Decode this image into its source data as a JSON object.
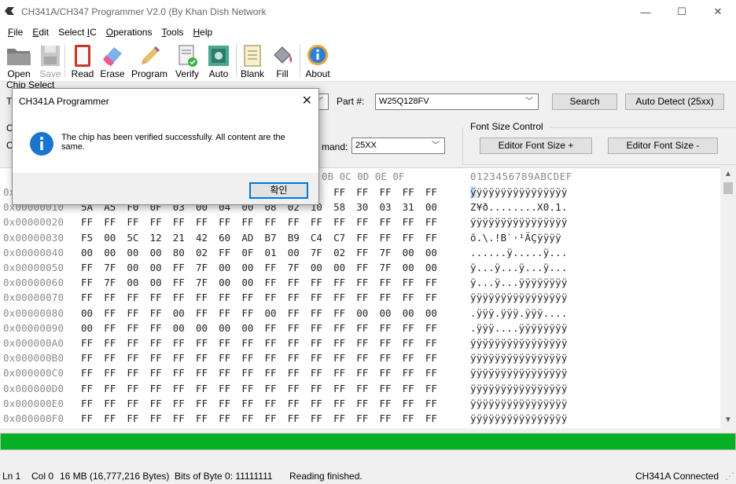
{
  "window": {
    "title": "CH341A/CH347 Programmer V2.0 (By Khan Dish Network",
    "minimize": "—",
    "maximize": "☐",
    "close": "✕"
  },
  "menu": [
    {
      "label": "File"
    },
    {
      "label": "Edit"
    },
    {
      "label": "Select IC"
    },
    {
      "label": "Operations"
    },
    {
      "label": "Tools"
    },
    {
      "label": "Help"
    }
  ],
  "toolbar": {
    "open": "Open",
    "save": "Save",
    "read": "Read",
    "erase": "Erase",
    "program": "Program",
    "verify": "Verify",
    "auto": "Auto",
    "blank": "Blank",
    "fill": "Fill",
    "about": "About"
  },
  "chip_select": {
    "group_label": "Chip Select",
    "part_label": "Part #:",
    "part_value": "W25Q128FV",
    "search": "Search",
    "auto_detect": "Auto Detect (25xx)",
    "command_label": "mand:",
    "command_value": "25XX",
    "partial_type_label": "T",
    "partial_c1": "C",
    "partial_c2": "C"
  },
  "font_size": {
    "group_label": "Font Size Control",
    "increase": "Editor Font Size +",
    "decrease": "Editor Font Size -"
  },
  "hex": {
    "header_cols": "A 0B 0C 0D 0E 0F",
    "ascii_header": "0123456789ABCDEF",
    "rows": [
      {
        "addr": "0x",
        "bytes": [
          "",
          "",
          "",
          "",
          "",
          "",
          "",
          "",
          "",
          "",
          "F",
          "FF",
          "FF",
          "FF",
          "FF",
          "FF"
        ],
        "ascii": "ÿÿÿÿÿÿÿÿÿÿÿÿÿÿÿÿ"
      },
      {
        "addr": "0x00000010",
        "bytes": [
          "5A",
          "A5",
          "F0",
          "0F",
          "03",
          "00",
          "04",
          "00",
          "08",
          "02",
          "10",
          "58",
          "30",
          "03",
          "31",
          "00"
        ],
        "ascii": "Z¥ð........X0.1."
      },
      {
        "addr": "0x00000020",
        "bytes": [
          "FF",
          "FF",
          "FF",
          "FF",
          "FF",
          "FF",
          "FF",
          "FF",
          "FF",
          "FF",
          "FF",
          "FF",
          "FF",
          "FF",
          "FF",
          "FF"
        ],
        "ascii": "ÿÿÿÿÿÿÿÿÿÿÿÿÿÿÿÿ"
      },
      {
        "addr": "0x00000030",
        "bytes": [
          "F5",
          "00",
          "5C",
          "12",
          "21",
          "42",
          "60",
          "AD",
          "B7",
          "B9",
          "C4",
          "C7",
          "FF",
          "FF",
          "FF",
          "FF"
        ],
        "ascii": "õ.\\.!B`­·¹ÄÇÿÿÿÿ"
      },
      {
        "addr": "0x00000040",
        "bytes": [
          "00",
          "00",
          "00",
          "00",
          "80",
          "02",
          "FF",
          "0F",
          "01",
          "00",
          "7F",
          "02",
          "FF",
          "7F",
          "00",
          "00"
        ],
        "ascii": "......ÿ.....ÿ..."
      },
      {
        "addr": "0x00000050",
        "bytes": [
          "FF",
          "7F",
          "00",
          "00",
          "FF",
          "7F",
          "00",
          "00",
          "FF",
          "7F",
          "00",
          "00",
          "FF",
          "7F",
          "00",
          "00"
        ],
        "ascii": "ÿ...ÿ...ÿ...ÿ..."
      },
      {
        "addr": "0x00000060",
        "bytes": [
          "FF",
          "7F",
          "00",
          "00",
          "FF",
          "7F",
          "00",
          "00",
          "FF",
          "FF",
          "FF",
          "FF",
          "FF",
          "FF",
          "FF",
          "FF"
        ],
        "ascii": "ÿ...ÿ...ÿÿÿÿÿÿÿÿ"
      },
      {
        "addr": "0x00000070",
        "bytes": [
          "FF",
          "FF",
          "FF",
          "FF",
          "FF",
          "FF",
          "FF",
          "FF",
          "FF",
          "FF",
          "FF",
          "FF",
          "FF",
          "FF",
          "FF",
          "FF"
        ],
        "ascii": "ÿÿÿÿÿÿÿÿÿÿÿÿÿÿÿÿ"
      },
      {
        "addr": "0x00000080",
        "bytes": [
          "00",
          "FF",
          "FF",
          "FF",
          "00",
          "FF",
          "FF",
          "FF",
          "00",
          "FF",
          "FF",
          "FF",
          "00",
          "00",
          "00",
          "00"
        ],
        "ascii": ".ÿÿÿ.ÿÿÿ.ÿÿÿ...."
      },
      {
        "addr": "0x00000090",
        "bytes": [
          "00",
          "FF",
          "FF",
          "FF",
          "00",
          "00",
          "00",
          "00",
          "FF",
          "FF",
          "FF",
          "FF",
          "FF",
          "FF",
          "FF",
          "FF"
        ],
        "ascii": ".ÿÿÿ....ÿÿÿÿÿÿÿÿ"
      },
      {
        "addr": "0x000000A0",
        "bytes": [
          "FF",
          "FF",
          "FF",
          "FF",
          "FF",
          "FF",
          "FF",
          "FF",
          "FF",
          "FF",
          "FF",
          "FF",
          "FF",
          "FF",
          "FF",
          "FF"
        ],
        "ascii": "ÿÿÿÿÿÿÿÿÿÿÿÿÿÿÿÿ"
      },
      {
        "addr": "0x000000B0",
        "bytes": [
          "FF",
          "FF",
          "FF",
          "FF",
          "FF",
          "FF",
          "FF",
          "FF",
          "FF",
          "FF",
          "FF",
          "FF",
          "FF",
          "FF",
          "FF",
          "FF"
        ],
        "ascii": "ÿÿÿÿÿÿÿÿÿÿÿÿÿÿÿÿ"
      },
      {
        "addr": "0x000000C0",
        "bytes": [
          "FF",
          "FF",
          "FF",
          "FF",
          "FF",
          "FF",
          "FF",
          "FF",
          "FF",
          "FF",
          "FF",
          "FF",
          "FF",
          "FF",
          "FF",
          "FF"
        ],
        "ascii": "ÿÿÿÿÿÿÿÿÿÿÿÿÿÿÿÿ"
      },
      {
        "addr": "0x000000D0",
        "bytes": [
          "FF",
          "FF",
          "FF",
          "FF",
          "FF",
          "FF",
          "FF",
          "FF",
          "FF",
          "FF",
          "FF",
          "FF",
          "FF",
          "FF",
          "FF",
          "FF"
        ],
        "ascii": "ÿÿÿÿÿÿÿÿÿÿÿÿÿÿÿÿ"
      },
      {
        "addr": "0x000000E0",
        "bytes": [
          "FF",
          "FF",
          "FF",
          "FF",
          "FF",
          "FF",
          "FF",
          "FF",
          "FF",
          "FF",
          "FF",
          "FF",
          "FF",
          "FF",
          "FF",
          "FF"
        ],
        "ascii": "ÿÿÿÿÿÿÿÿÿÿÿÿÿÿÿÿ"
      },
      {
        "addr": "0x000000F0",
        "bytes": [
          "FF",
          "FF",
          "FF",
          "FF",
          "FF",
          "FF",
          "FF",
          "FF",
          "FF",
          "FF",
          "FF",
          "FF",
          "FF",
          "FF",
          "FF",
          "FF"
        ],
        "ascii": "ÿÿÿÿÿÿÿÿÿÿÿÿÿÿÿÿ"
      }
    ]
  },
  "progress": {
    "percent": 100,
    "color": "#06b025"
  },
  "status": {
    "line": "Ln 1",
    "col": "Col 0",
    "size": "16 MB (16,777,216 Bytes)",
    "bits": "Bits of Byte 0: 11111111",
    "message": "Reading finished.",
    "connection": "CH341A Connected"
  },
  "dialog": {
    "title": "CH341A Programmer",
    "message": "The chip has been verified successfully. All content are the same.",
    "ok": "확인",
    "close": "✕",
    "icon": "info-icon"
  },
  "colors": {
    "accent": "#0078d7",
    "progress": "#06b025",
    "info": "#1a75cf"
  }
}
